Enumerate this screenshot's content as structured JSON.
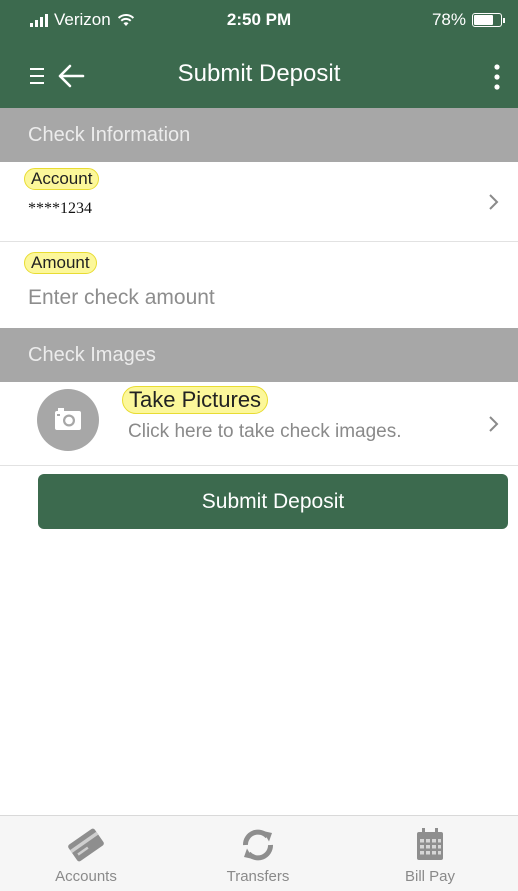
{
  "status_bar": {
    "carrier": "Verizon",
    "time": "2:50 PM",
    "battery": "78%",
    "battery_level": 0.78
  },
  "nav": {
    "title": "Submit Deposit",
    "icons": [
      "menu-icon",
      "back-arrow-icon",
      "more-vert-icon"
    ]
  },
  "sections": {
    "check_information": "Check Information",
    "check_images": "Check Images"
  },
  "account": {
    "label": "Account",
    "value": "****1234"
  },
  "amount": {
    "label": "Amount",
    "placeholder": "Enter check amount",
    "value": ""
  },
  "pictures": {
    "title": "Take Pictures",
    "subtitle": "Click here to take check images."
  },
  "submit_label": "Submit Deposit",
  "tabs": [
    {
      "label": "Accounts",
      "icon": "accounts-card-icon"
    },
    {
      "label": "Transfers",
      "icon": "transfers-refresh-icon"
    },
    {
      "label": "Bill Pay",
      "icon": "bill-pay-calendar-icon"
    }
  ],
  "colors": {
    "brand_green": "#3c6a4e",
    "section_gray": "#a7a7a7",
    "highlight_yellow": "#fcf79a"
  }
}
